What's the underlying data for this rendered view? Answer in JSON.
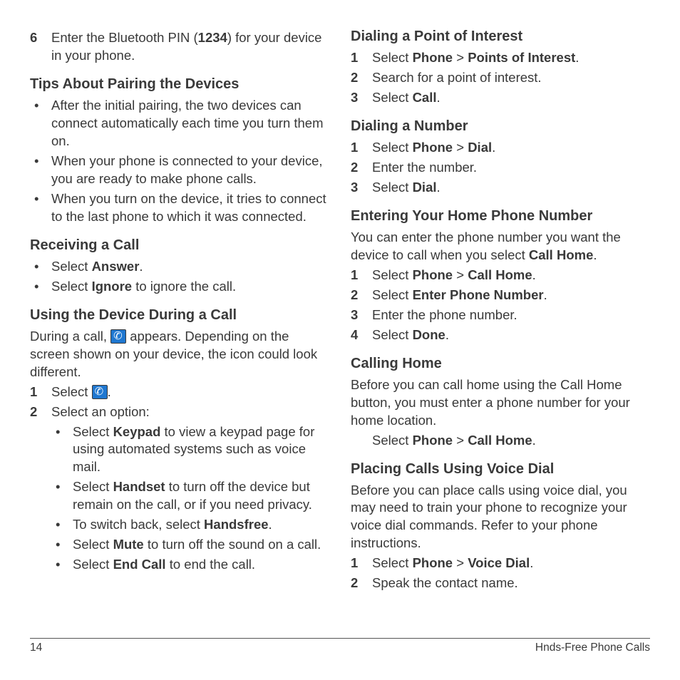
{
  "left": {
    "step6_pre": "Enter the Bluetooth PIN (",
    "step6_pin": "1234",
    "step6_post": ") for your device in your phone.",
    "tips_heading": "Tips About Pairing the Devices",
    "tip1": "After the initial pairing, the two devices can connect automatically each time you turn them on.",
    "tip2": "When your phone is connected to your device, you are ready to make phone calls.",
    "tip3": "When you turn on the device, it tries to connect to the last phone to which it was connected.",
    "receiving_heading": "Receiving a Call",
    "recv1_pre": "Select ",
    "recv1_bold": "Answer",
    "recv1_post": ".",
    "recv2_pre": "Select ",
    "recv2_bold": "Ignore",
    "recv2_post": " to ignore the call.",
    "using_heading": "Using the Device During a Call",
    "using_intro_pre": "During a call, ",
    "using_intro_post": " appears. Depending on the screen shown on your device, the icon could look different.",
    "using1_pre": "Select ",
    "using1_post": ".",
    "using2": "Select an option:",
    "opt_keypad_pre": "Select ",
    "opt_keypad_bold": "Keypad",
    "opt_keypad_post": " to view a keypad page for using automated systems such as voice mail.",
    "opt_handset_pre": "Select ",
    "opt_handset_bold": "Handset",
    "opt_handset_post": " to turn off the device but remain on the call, or if you need privacy.",
    "opt_switch_pre": "To switch back, select ",
    "opt_switch_bold": "Handsfree",
    "opt_switch_post": ".",
    "opt_mute_pre": "Select ",
    "opt_mute_bold": "Mute",
    "opt_mute_post": " to turn off the sound on a call.",
    "opt_end_pre": "Select ",
    "opt_end_bold": "End Call",
    "opt_end_post": " to end the call."
  },
  "right": {
    "poi_heading": "Dialing a Point of Interest",
    "poi1_pre": "Select ",
    "poi1_b1": "Phone",
    "poi1_mid": " > ",
    "poi1_b2": "Points of Interest",
    "poi1_post": ".",
    "poi2": "Search for a point of interest.",
    "poi3_pre": "Select ",
    "poi3_bold": "Call",
    "poi3_post": ".",
    "dial_heading": "Dialing a Number",
    "dial1_pre": "Select ",
    "dial1_b1": "Phone",
    "dial1_mid": " > ",
    "dial1_b2": "Dial",
    "dial1_post": ".",
    "dial2": "Enter the number.",
    "dial3_pre": "Select ",
    "dial3_bold": "Dial",
    "dial3_post": ".",
    "home_heading": "Entering Your Home Phone Number",
    "home_intro_pre": "You can enter the phone number you want the device to call when you select ",
    "home_intro_bold": "Call Home",
    "home_intro_post": ".",
    "home1_pre": "Select ",
    "home1_b1": "Phone",
    "home1_mid": " > ",
    "home1_b2": "Call Home",
    "home1_post": ".",
    "home2_pre": "Select ",
    "home2_bold": "Enter Phone Number",
    "home2_post": ".",
    "home3": "Enter the phone number.",
    "home4_pre": "Select ",
    "home4_bold": "Done",
    "home4_post": ".",
    "calling_heading": "Calling Home",
    "calling_intro": "Before you can call home using the Call Home button, you must enter a phone number for your home location.",
    "calling_step_pre": "Select ",
    "calling_step_b1": "Phone",
    "calling_step_mid": " > ",
    "calling_step_b2": "Call Home",
    "calling_step_post": ".",
    "voice_heading": "Placing Calls Using Voice Dial",
    "voice_intro": "Before you can place calls using voice dial, you may need to train your phone to recognize your voice dial commands. Refer to your phone instructions.",
    "voice1_pre": "Select ",
    "voice1_b1": "Phone",
    "voice1_mid": " > ",
    "voice1_b2": "Voice Dial",
    "voice1_post": ".",
    "voice2": "Speak the contact name."
  },
  "footer": {
    "page": "14",
    "section": "Hnds-Free Phone Calls"
  },
  "nums": {
    "n1": "1",
    "n2": "2",
    "n3": "3",
    "n4": "4",
    "n6": "6"
  },
  "bullet": "•"
}
